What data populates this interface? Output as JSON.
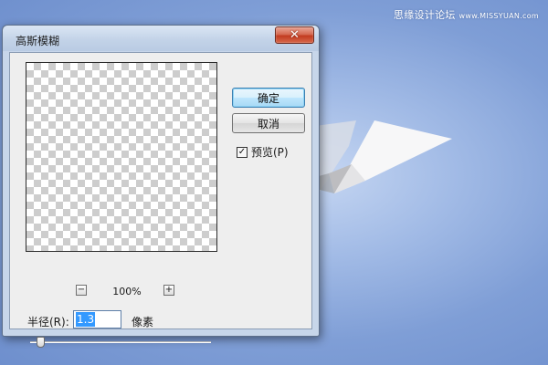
{
  "watermark": {
    "text": "思缘设计论坛",
    "site": "www.MISSYUAN.com"
  },
  "dialog": {
    "title": "高斯模糊",
    "close_glyph": "✕",
    "ok_label": "确定",
    "cancel_label": "取消",
    "preview_label": "预览(P)",
    "preview_checked": true,
    "check_glyph": "✓",
    "zoom": {
      "minus": "−",
      "plus": "+",
      "level": "100%"
    },
    "radius": {
      "label": "半径(R):",
      "value": "1.3",
      "unit": "像素",
      "slider_fraction": 0.06
    }
  },
  "icons": {
    "close": "close-icon",
    "checkbox": "checkmark-icon",
    "zoom_out": "minus-icon",
    "zoom_in": "plus-icon",
    "plane": "paper-plane-graphic"
  },
  "colors": {
    "background": "#8aa7dc",
    "close_button": "#c8452b",
    "ok_button": "#bee6fd",
    "selection": "#3399ff"
  }
}
